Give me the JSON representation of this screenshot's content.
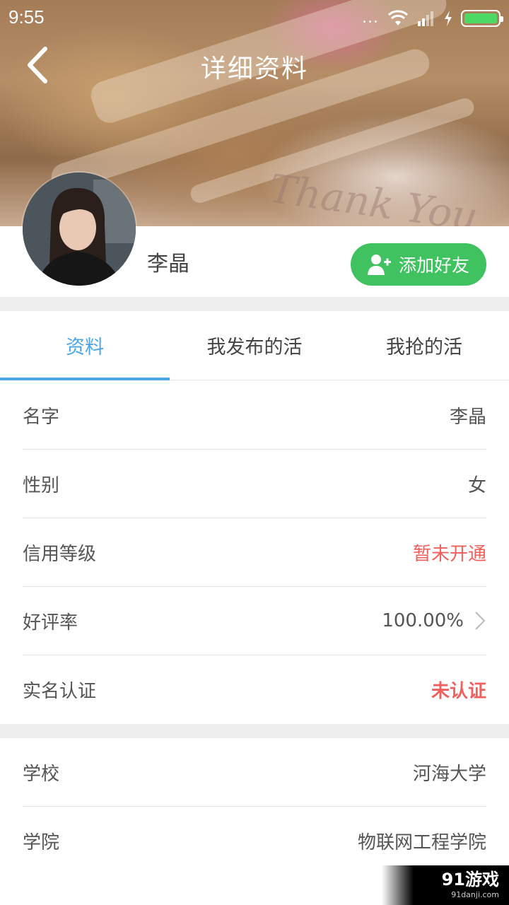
{
  "status_bar": {
    "time": "9:55",
    "dots": "...",
    "battery_color": "#4cd964"
  },
  "header": {
    "title": "详细资料",
    "back_icon": "chevron-left-icon",
    "background_script": "Thank You"
  },
  "profile": {
    "name": "李晶",
    "add_friend_label": "添加好友",
    "add_friend_icon": "add-user-icon",
    "button_color": "#3fc25f"
  },
  "tabs": [
    {
      "label": "资料",
      "active": true
    },
    {
      "label": "我发布的活",
      "active": false
    },
    {
      "label": "我抢的活",
      "active": false
    }
  ],
  "info": [
    {
      "label": "名字",
      "value": "李晶"
    },
    {
      "label": "性别",
      "value": "女"
    },
    {
      "label": "信用等级",
      "value": "暂未开通",
      "color": "#f0605d"
    },
    {
      "label": "好评率",
      "value": "100.00%",
      "icon": "chevron-right-icon"
    },
    {
      "label": "实名认证",
      "value": "未认证",
      "color": "#f0605d"
    }
  ],
  "school_info": [
    {
      "label": "学校",
      "value": "河海大学"
    },
    {
      "label": "学院",
      "value": "物联网工程学院"
    }
  ],
  "watermark": {
    "main": "91游戏",
    "sub": "91danji.com"
  },
  "accent_color": "#4aa6e8"
}
